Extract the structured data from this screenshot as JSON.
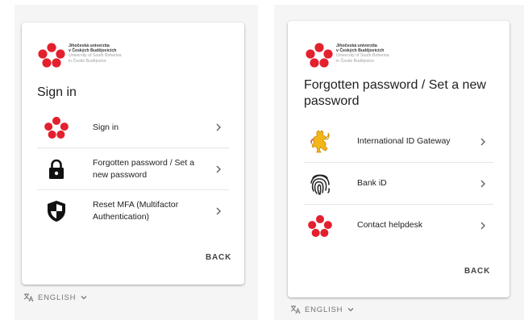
{
  "logo": {
    "line1": "Jihočeská univerzita",
    "line2": "v Českých Budějovicích",
    "line3": "University of South Bohemia",
    "line4": "in České Budějovice"
  },
  "left": {
    "title": "Sign in",
    "items": [
      {
        "label": "Sign in",
        "icon": "university-logo-icon"
      },
      {
        "label": "Forgotten password / Set a new password",
        "icon": "lock-icon"
      },
      {
        "label": "Reset MFA (Multifactor Authentication)",
        "icon": "shield-icon"
      }
    ],
    "back": "BACK",
    "language": "ENGLISH"
  },
  "right": {
    "title": "Forgotten password / Set a new password",
    "items": [
      {
        "label": "International ID Gateway",
        "icon": "lion-emblem-icon"
      },
      {
        "label": "Bank iD",
        "icon": "fingerprint-icon"
      },
      {
        "label": "Contact helpdesk",
        "icon": "university-logo-icon"
      }
    ],
    "back": "BACK",
    "language": "ENGLISH"
  },
  "colors": {
    "brand_red": "#e4202e",
    "background": "#f5f5f5",
    "card": "#ffffff",
    "text": "#212121",
    "muted": "#757575",
    "lion_gold": "#f2b619"
  }
}
